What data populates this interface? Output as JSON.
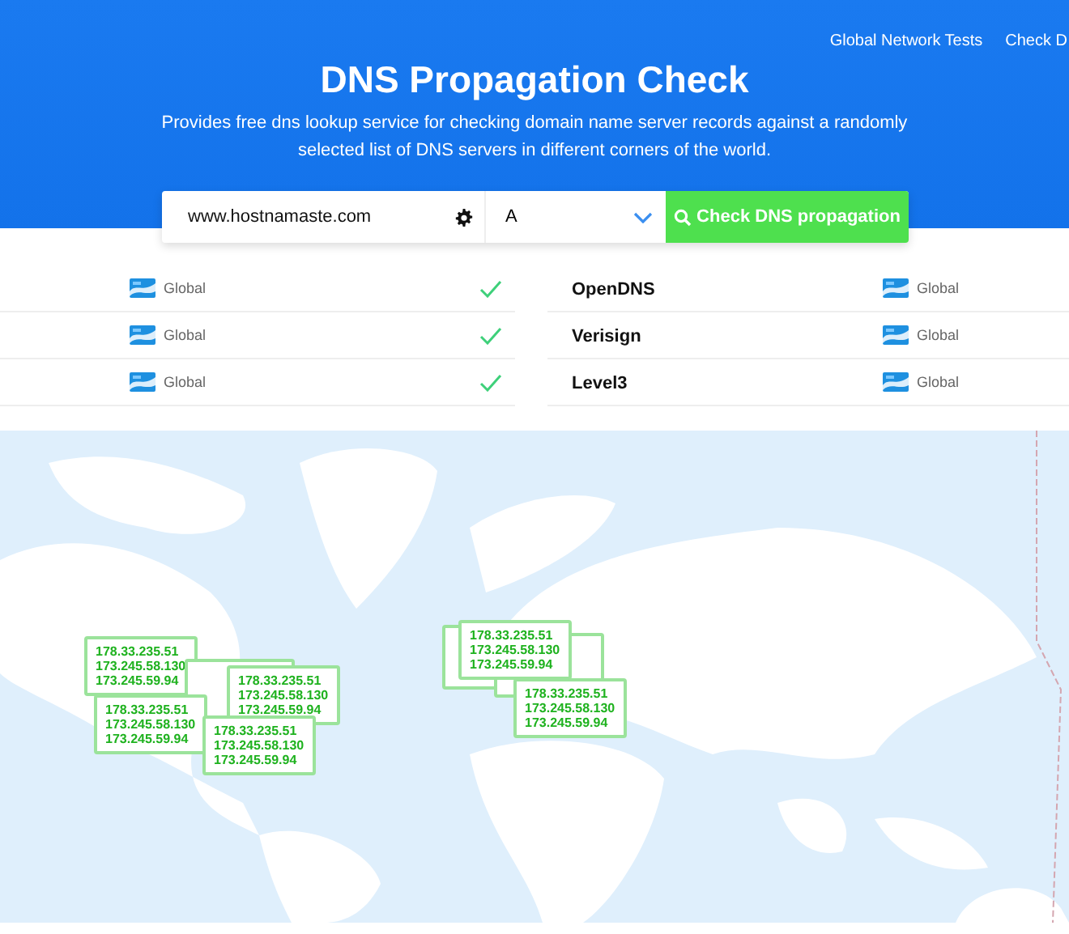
{
  "nav": [
    "Global Network Tests",
    "Check D"
  ],
  "header": {
    "title": "DNS Propagation Check",
    "subtitle": "Provides free dns lookup service for checking domain name server records against a randomly selected list of DNS servers in different corners of the world."
  },
  "search": {
    "value": "www.hostnamaste.com",
    "record_type": "A",
    "button": "Check DNS propagation"
  },
  "results": [
    {
      "rows": [
        {
          "location": "Global",
          "resolved": true
        },
        {
          "location": "Global",
          "resolved": true
        },
        {
          "location": "Global",
          "resolved": true
        }
      ]
    },
    {
      "rows": [
        {
          "name": "OpenDNS",
          "location": "Global"
        },
        {
          "name": "Verisign",
          "location": "Global"
        },
        {
          "name": "Level3",
          "location": "Global"
        }
      ]
    }
  ],
  "map": {
    "kind": "picture",
    "markers": [
      {
        "kind": "popup",
        "ips": [
          "178.33.235.51",
          "173.245.58.130",
          "173.245.59.94"
        ]
      },
      {
        "kind": "covered"
      },
      {
        "kind": "popup",
        "ips": [
          "178.33.235.51",
          "173.245.58.130",
          "173.245.59.94"
        ]
      },
      {
        "kind": "popup",
        "ips": [
          "178.33.235.51",
          "173.245.58.130",
          "173.245.59.94"
        ]
      },
      {
        "kind": "popup",
        "ips": [
          "178.33.235.51",
          "173.245.58.130",
          "173.245.59.94"
        ]
      },
      {
        "kind": "covered"
      },
      {
        "kind": "covered"
      },
      {
        "kind": "popup",
        "ips": [
          "178.33.235.51",
          "173.245.58.130",
          "173.245.59.94"
        ]
      },
      {
        "kind": "popup",
        "ips": [
          "178.33.235.51",
          "173.245.58.130",
          "173.245.59.94"
        ]
      }
    ]
  }
}
